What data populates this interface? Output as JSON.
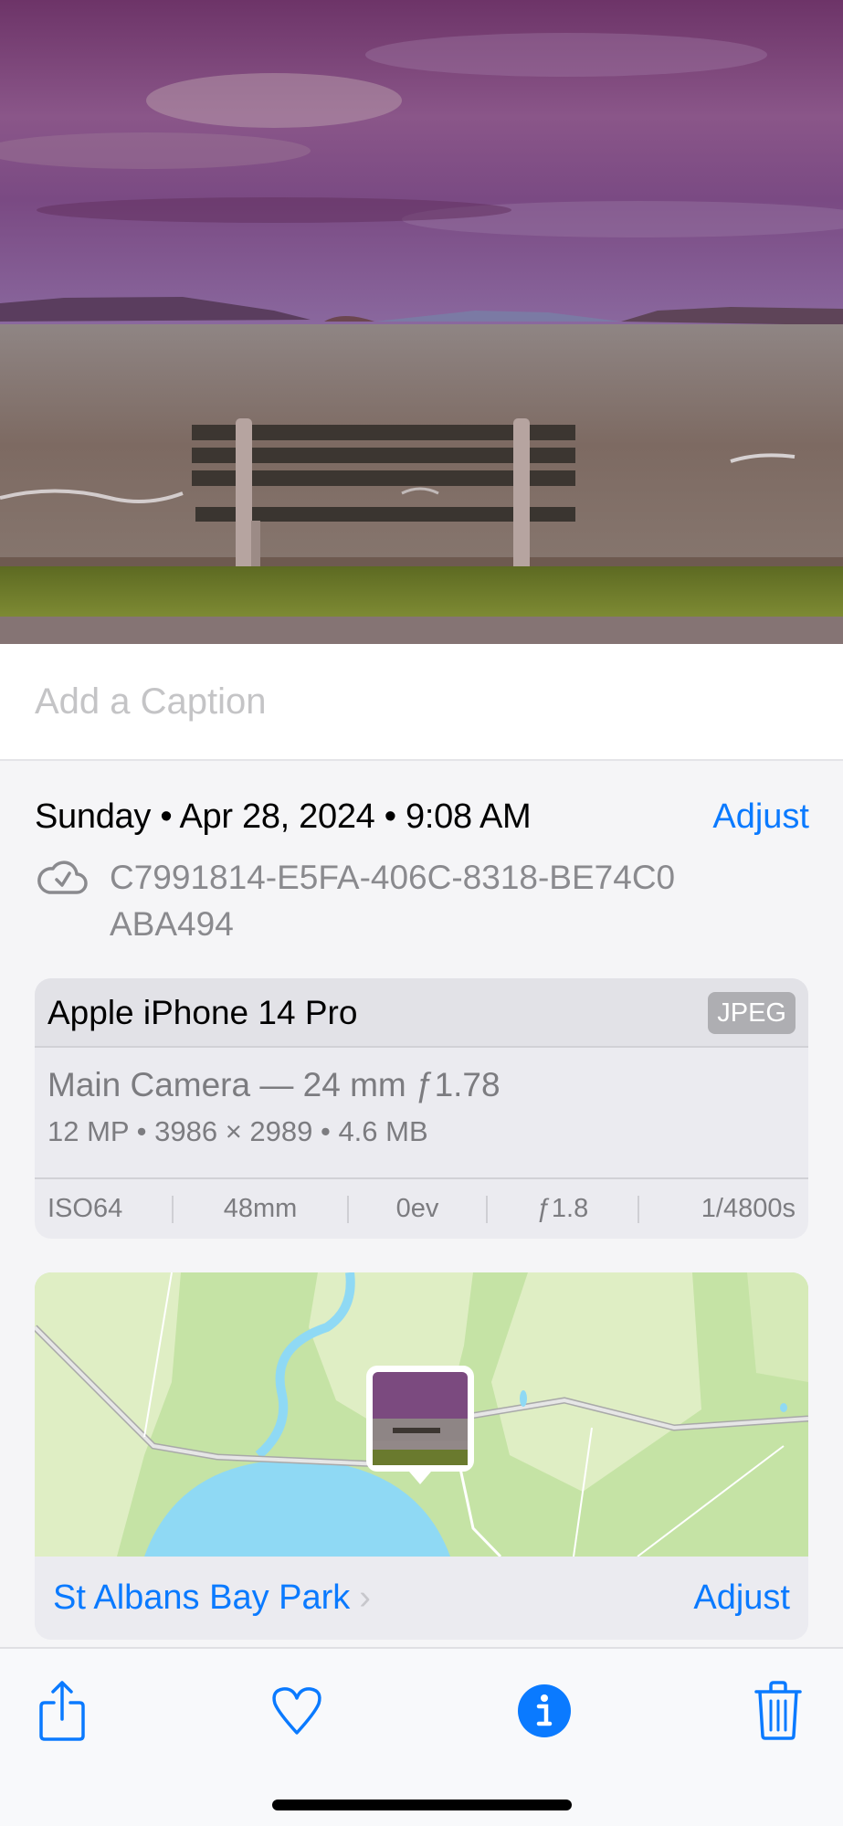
{
  "photo": {
    "description": "Bench facing a choppy lake under a purple cloudy sky, with grass and a gravel path in the foreground",
    "colors": {
      "sky": "#7a3f7e",
      "water": "#8b7a72",
      "grass": "#6f7a2a",
      "path": "#9a9090"
    }
  },
  "caption": {
    "placeholder": "Add a Caption",
    "value": ""
  },
  "info": {
    "date": "Sunday • Apr 28, 2024 • 9:08 AM",
    "adjust_label": "Adjust",
    "cloud_icon": "icloud-checkmark-icon",
    "uuid": "C7991814-E5FA-406C-8318-BE74C0ABA494"
  },
  "metadata": {
    "device": "Apple iPhone 14 Pro",
    "format": "JPEG",
    "camera": "Main Camera — 24 mm ƒ1.78",
    "specs": "12 MP  •  3986 × 2989  •  4.6 MB",
    "exif": [
      "ISO64",
      "48mm",
      "0ev",
      "ƒ1.8",
      "1/4800s"
    ]
  },
  "location": {
    "place": "St Albans Bay Park",
    "chevron": "›",
    "adjust_label": "Adjust"
  },
  "toolbar": {
    "items": [
      {
        "name": "share",
        "icon": "share-icon"
      },
      {
        "name": "favorite",
        "icon": "heart-icon"
      },
      {
        "name": "info",
        "icon": "info-icon",
        "active": true
      },
      {
        "name": "delete",
        "icon": "trash-icon"
      }
    ]
  },
  "colors": {
    "accent": "#0a7aff",
    "secondary_text": "#8a8a8e",
    "placeholder": "#c4c4c6"
  }
}
